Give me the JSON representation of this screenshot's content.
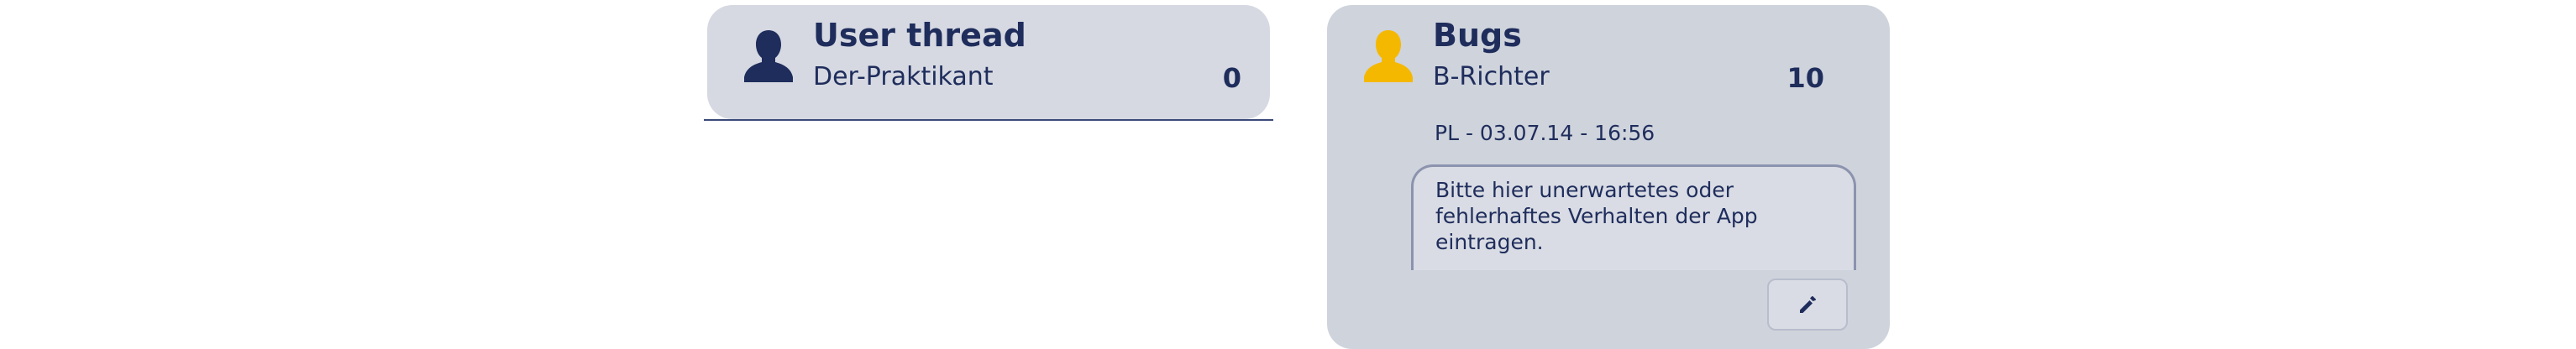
{
  "colors": {
    "card_background": "#d6d9e2",
    "text": "#1f2d5c",
    "avatar_default": "#1f2d5c",
    "avatar_highlight": "#f5b800"
  },
  "threads": [
    {
      "title": "User thread",
      "author": "Der-Praktikant",
      "count": "0",
      "avatar_icon": "user-silhouette-icon"
    },
    {
      "title": "Bugs",
      "author": "B-Richter",
      "count": "10",
      "avatar_icon": "user-silhouette-icon",
      "last_post": "PL - 03.07.14 - 16:56",
      "message": "Bitte hier unerwartetes oder fehlerhaftes Verhalten der App eintragen.",
      "edit_icon": "pencil-icon"
    }
  ]
}
